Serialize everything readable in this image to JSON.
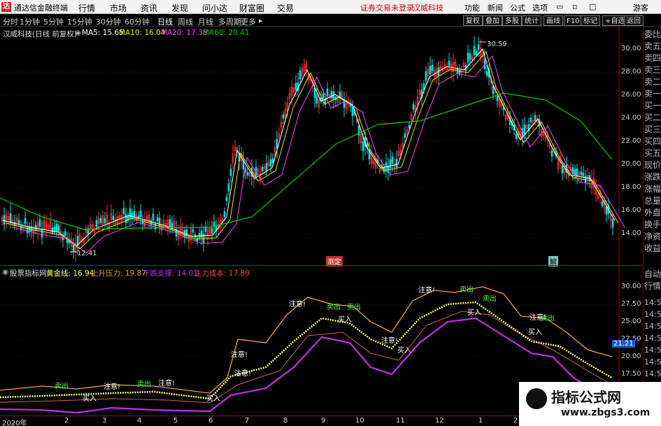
{
  "titlebar": {
    "app_name": "通达信金融终端",
    "menu": [
      "行情",
      "市场",
      "资讯",
      "发现",
      "问小达",
      "财富圈",
      "交易"
    ],
    "notice": "证券交易未登录",
    "stock": "汉威科技",
    "right_menu": [
      "功能",
      "新闻",
      "公式",
      "选项"
    ],
    "guest": "游客"
  },
  "periods": [
    "分时",
    "1分钟",
    "5分钟",
    "15分钟",
    "30分钟",
    "60分钟",
    "日线",
    "周线",
    "月线",
    "多周期",
    "更多"
  ],
  "active_period": "日线",
  "tools": [
    "复权",
    "叠加",
    "多股",
    "统计",
    "画线",
    "F10",
    "标记",
    "+自选",
    "返回"
  ],
  "main_legend": {
    "stock_title": "汉威科技(日线 前复权)",
    "ma5": "MA5: 15.65",
    "ma10": "MA10: 16.04",
    "ma20": "MA20: 17.38",
    "ma60": "MA60: 20.41"
  },
  "main_price_labels": [
    "30.00",
    "28.00",
    "26.00",
    "24.00",
    "22.00",
    "20.00",
    "18.00",
    "16.00",
    "14.00"
  ],
  "high_label": "30.59",
  "low_label": "12.41",
  "sub_legend": {
    "name": "股票指标网",
    "gold": "黄金线: 16.94",
    "up": "上升压力: 19.87",
    "down": "下跌支撑: 14.01",
    "cost": "主力成本: 17.89"
  },
  "sub_price_labels": [
    "30.00",
    "27.50",
    "25.00",
    "22.50",
    "20.00",
    "17.50"
  ],
  "sub_current": "21.21",
  "right_panel": [
    "委比",
    "卖五",
    "卖四",
    "卖三",
    "卖二",
    "卖一",
    "买一",
    "买二",
    "买三",
    "买四",
    "买五",
    "现价",
    "涨跌",
    "涨幅",
    "总量",
    "外盘",
    "换手",
    "净资",
    "收益",
    "自动",
    "行情"
  ],
  "right_times": [
    "14:50",
    "14:50",
    "14:50",
    "14:50",
    "14:50",
    "14:50",
    "14:50"
  ],
  "xaxis": [
    "2020年",
    "2",
    "3",
    "4",
    "5",
    "6",
    "7",
    "8",
    "9",
    "10",
    "11",
    "12",
    "1",
    "2",
    "3"
  ],
  "event_labels": [
    "测定",
    "解"
  ],
  "annotations": {
    "attention": "注意!",
    "sell": "卖出",
    "buy": "买入"
  },
  "watermark": {
    "title": "指标公式网",
    "url": "www.zbgs3.com"
  },
  "colors": {
    "ma5": "#ffffff",
    "ma10": "#e8e800",
    "ma20": "#ff40ff",
    "ma60": "#00cc00",
    "up": "#ff3030",
    "down": "#00e0e0",
    "resistance": "#f0a040",
    "gold": "#ffff60",
    "support": "#c030e0"
  }
}
